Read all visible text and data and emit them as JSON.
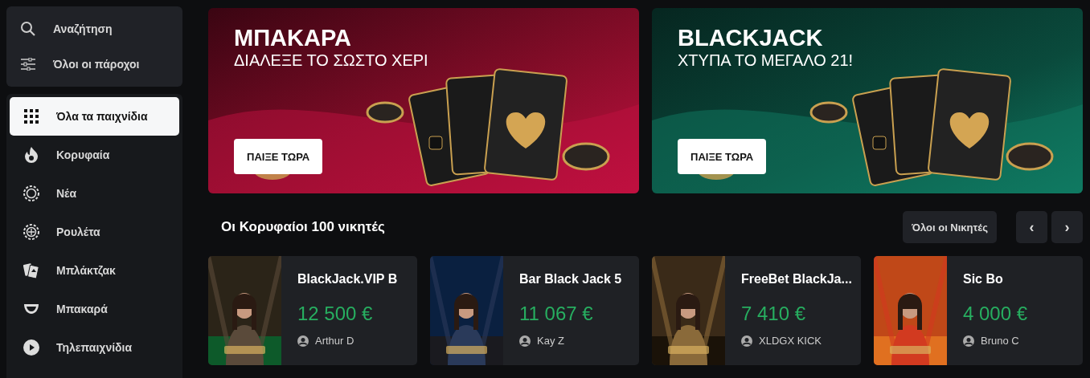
{
  "sidebar": {
    "tools": [
      {
        "label": "Αναζήτηση"
      },
      {
        "label": "Όλοι οι πάροχοι"
      }
    ],
    "items": [
      {
        "label": "Όλα τα παιχνίδια",
        "selected": true
      },
      {
        "label": "Κορυφαία",
        "selected": false
      },
      {
        "label": "Νέα",
        "selected": false
      },
      {
        "label": "Ρουλέτα",
        "selected": false
      },
      {
        "label": "Μπλάκτζακ",
        "selected": false
      },
      {
        "label": "Μπακαρά",
        "selected": false
      },
      {
        "label": "Τηλεπαιχνίδια",
        "selected": false
      }
    ]
  },
  "banners": [
    {
      "title": "ΜΠΑΚΑΡΑ",
      "subtitle": "ΔΙΑΛΕΞΕ ΤΟ ΣΩΣΤΟ ΧΕΡΙ",
      "button": "ΠΑΙΞΕ ΤΩΡΑ"
    },
    {
      "title": "BLACKJACK",
      "subtitle": "ΧΤΥΠΑ ΤΟ ΜΕΓΑΛΟ 21!",
      "button": "ΠΑΙΞΕ ΤΩΡΑ"
    }
  ],
  "winners": {
    "title": "Οι Κορυφαίοι 100 νικητές",
    "all_button": "Όλοι οι Νικητές",
    "prev": "‹",
    "next": "›",
    "cards": [
      {
        "game": "BlackJack.VIP B",
        "amount": "12 500 €",
        "player": "Arthur D"
      },
      {
        "game": "Bar Black Jack 5",
        "amount": "11 067 €",
        "player": "Kay Z"
      },
      {
        "game": "FreeBet BlackJa...",
        "amount": "7 410 €",
        "player": "XLDGX KICK"
      },
      {
        "game": "Sic Bo",
        "amount": "4 000 €",
        "player": "Bruno C"
      }
    ]
  }
}
